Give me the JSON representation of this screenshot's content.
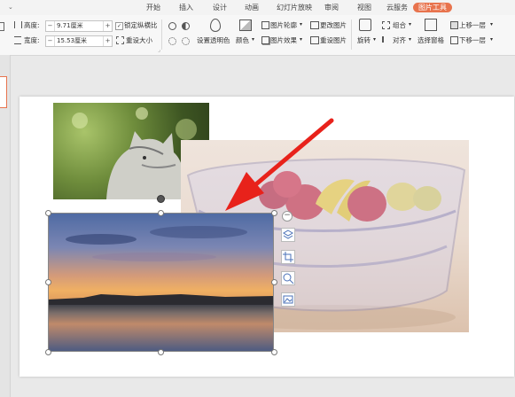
{
  "tabs": [
    {
      "label": "开始",
      "active": false
    },
    {
      "label": "插入",
      "active": false
    },
    {
      "label": "设计",
      "active": false
    },
    {
      "label": "动画",
      "active": false
    },
    {
      "label": "幻灯片放映",
      "active": false
    },
    {
      "label": "审阅",
      "active": false
    },
    {
      "label": "视图",
      "active": false
    },
    {
      "label": "云服务",
      "active": false
    },
    {
      "label": "图片工具",
      "active": true
    }
  ],
  "size": {
    "height_label": "高度:",
    "height_value": "9.71厘米",
    "width_label": "宽度:",
    "width_value": "15.53厘米",
    "lock_ratio_label": "锁定纵横比",
    "lock_ratio_checked": true,
    "reset_size_label": "重设大小"
  },
  "picture": {
    "transparent_label": "设置透明色",
    "color_label": "颜色",
    "outline_label": "图片轮廓",
    "effect_label": "图片效果",
    "change_label": "更改图片",
    "reset_label": "重设图片"
  },
  "arrange": {
    "rotate_label": "旋转",
    "group_label": "组合",
    "align_label": "对齐",
    "selection_pane_label": "选择窗格",
    "bring_forward_label": "上移一层",
    "send_backward_label": "下移一层"
  },
  "colors": {
    "accent": "#e8734d",
    "arrow": "#e8221b"
  },
  "icons": [
    "minus-icon",
    "plus-icon",
    "transparent-color-icon",
    "color-icon",
    "outline-icon",
    "effect-icon",
    "change-picture-icon",
    "reset-picture-icon",
    "rotate-icon",
    "group-icon",
    "align-icon",
    "selection-pane-icon",
    "bring-forward-icon",
    "send-backward-icon",
    "layers-icon",
    "crop-icon",
    "zoom-icon",
    "image-fill-icon",
    "rotate-handle-icon"
  ]
}
